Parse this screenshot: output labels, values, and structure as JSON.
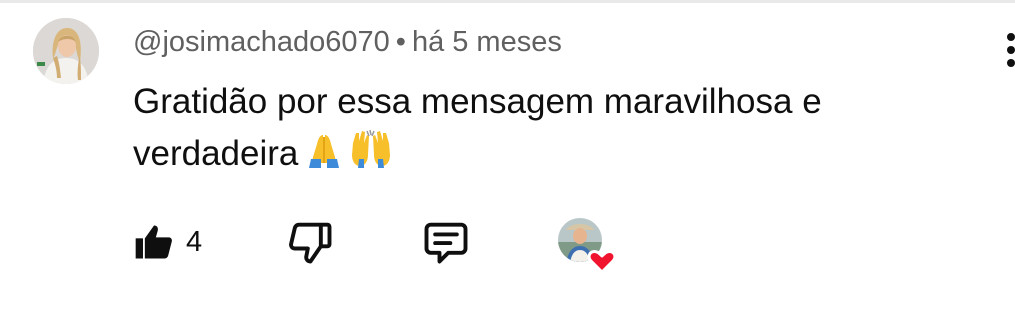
{
  "comment": {
    "author": "@josimachado6070",
    "separator": "•",
    "time": "há 5 meses",
    "text": "Gratidão por essa mensagem maravilhosa e verdadeira",
    "emojis": [
      "folded-hands-emoji",
      "raising-hands-emoji"
    ],
    "like_count": "4",
    "liked": true
  },
  "icons": {
    "menu": "vertical-ellipsis-icon",
    "like": "thumbs-up-icon",
    "dislike": "thumbs-down-icon",
    "reply": "comment-bubble-icon",
    "creator_heart": "creator-heart-icon"
  },
  "colors": {
    "text_primary": "#0f0f0f",
    "text_secondary": "#606060",
    "heart": "#f0142f",
    "emoji_yellow": "#fbc02d",
    "emoji_blue": "#3d8bd9"
  }
}
